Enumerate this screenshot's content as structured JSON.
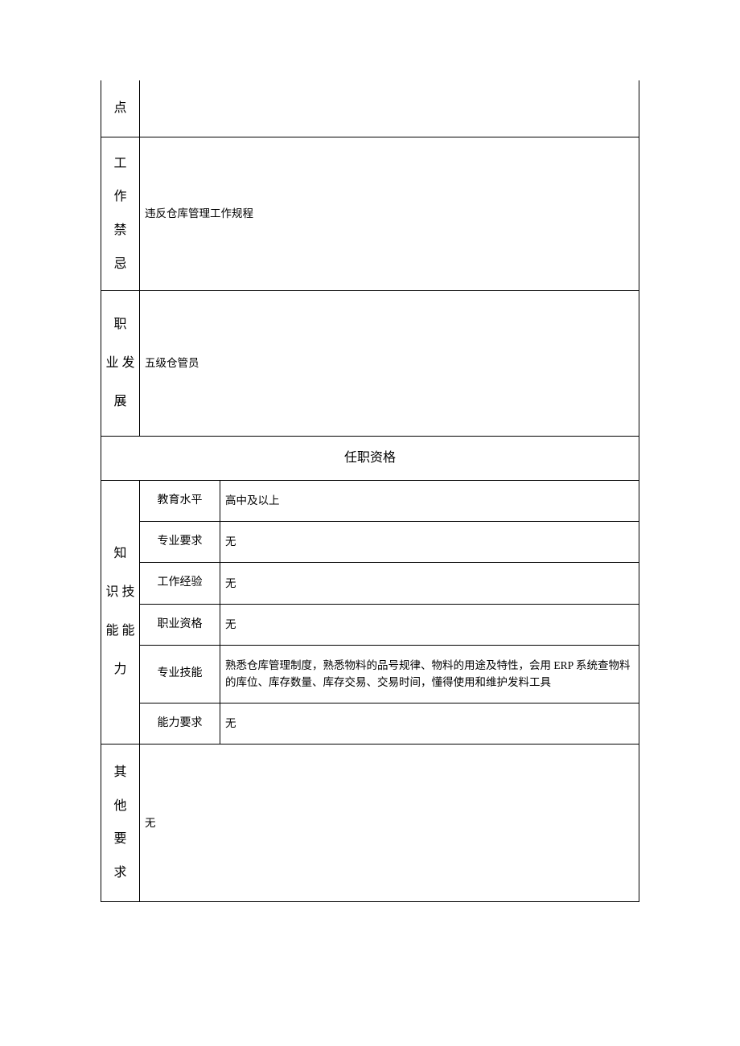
{
  "row1": {
    "label": "点",
    "value": ""
  },
  "row2": {
    "label": [
      "工",
      "作",
      "禁",
      "忌"
    ],
    "value": "违反仓库管理工作规程"
  },
  "row3": {
    "label": [
      "职",
      "业 发",
      "展"
    ],
    "value": "五级仓管员"
  },
  "header": "任职资格",
  "section": {
    "label": [
      "知",
      "识 技",
      "能 能",
      "力"
    ],
    "rows": [
      {
        "k": "教育水平",
        "v": "高中及以上"
      },
      {
        "k": "专业要求",
        "v": "无"
      },
      {
        "k": "工作经验",
        "v": "无"
      },
      {
        "k": "职业资格",
        "v": "无"
      },
      {
        "k": "专业技能",
        "v": "熟悉仓库管理制度，熟悉物料的品号规律、物料的用途及特性，会用 ERP 系统查物料的库位、库存数量、库存交易、交易时间，懂得使用和维护发料工具"
      },
      {
        "k": "能力要求",
        "v": "无"
      }
    ]
  },
  "row_last": {
    "label": [
      "其",
      "他",
      "要",
      "求"
    ],
    "value": "无"
  }
}
